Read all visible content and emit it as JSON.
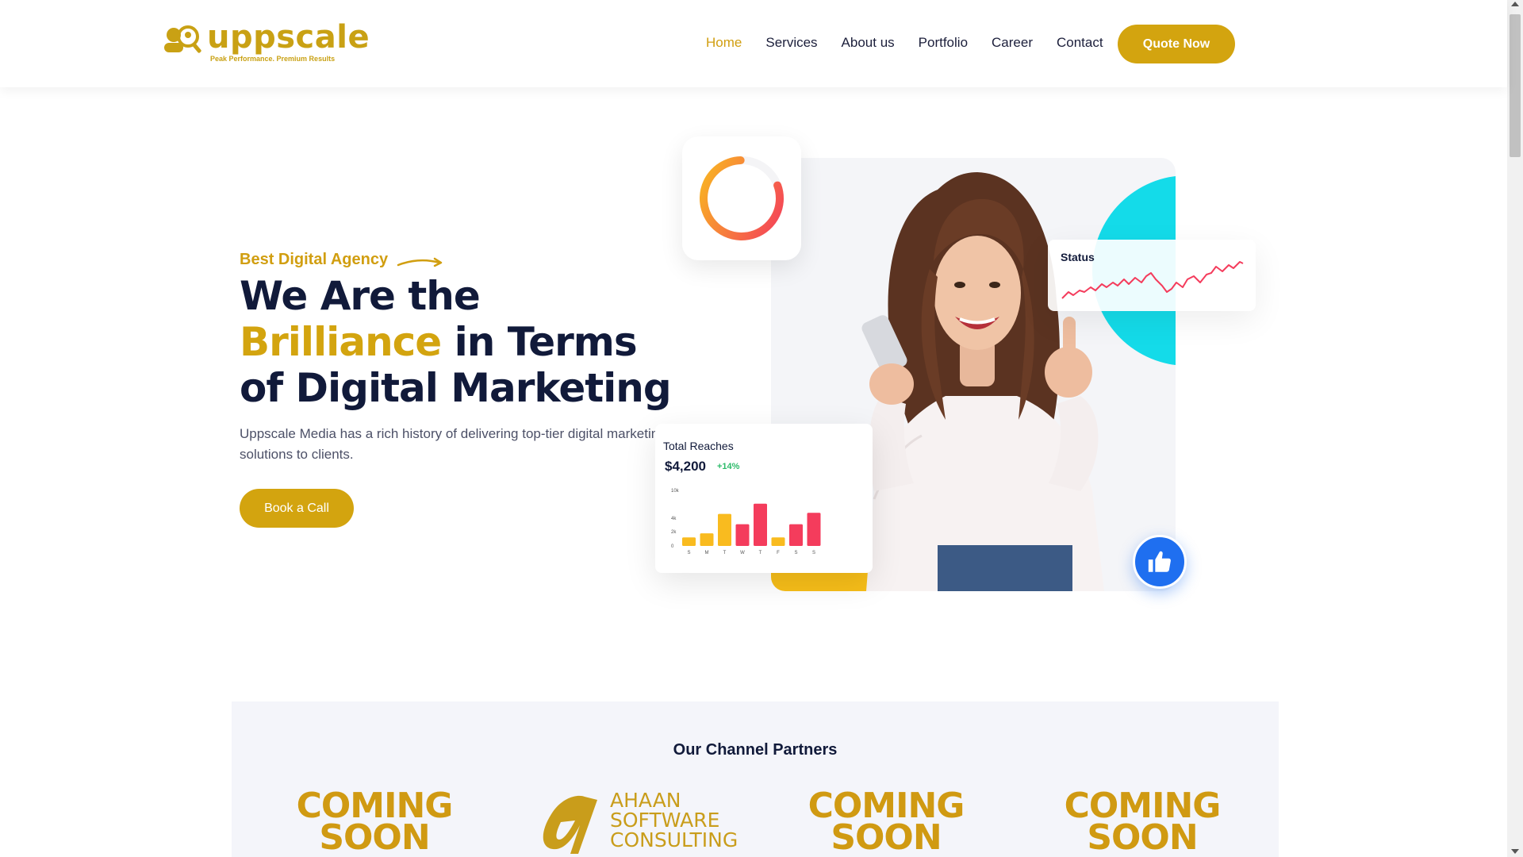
{
  "header": {
    "brand_name": "uppscale",
    "brand_tagline": "Peak Performance. Premium Results",
    "nav": [
      "Home",
      "Services",
      "About us",
      "Portfolio",
      "Career",
      "Contact"
    ],
    "cta": "Quote Now"
  },
  "hero": {
    "eyebrow": "Best Digital Agency",
    "title_part1": "We Are the ",
    "title_highlight": "Brilliance",
    "title_part2": " in Terms of Digital Marketing",
    "description_line1": "Uppscale Media has a rich history of delivering top-tier digital marketing",
    "description_line2": "solutions to clients.",
    "button": "Book a Call"
  },
  "widgets": {
    "status_title": "Status",
    "reach_title": "Total Reaches",
    "reach_value": "$4,200",
    "reach_change": "+14%",
    "progress_fraction": 0.8
  },
  "chart_data": {
    "type": "bar",
    "categories": [
      "S",
      "M",
      "T",
      "W",
      "T",
      "F",
      "S",
      "S"
    ],
    "values": [
      1.5,
      2.2,
      5.6,
      3.8,
      7.4,
      1.5,
      3.8,
      5.8
    ],
    "colors": [
      "#f9bb1f",
      "#f9bb1f",
      "#f9bb1f",
      "#f43c5c",
      "#f43c5c",
      "#f9bb1f",
      "#f43c5c",
      "#f43c5c"
    ],
    "yticks": [
      "0",
      "2k",
      "4k",
      "10k"
    ],
    "ylim": [
      0,
      10
    ]
  },
  "partners": {
    "title": "Our Channel Partners",
    "coming_line1": "COMING",
    "coming_line2": "SOON",
    "ahaan_line1": "AHAAN",
    "ahaan_line2": "SOFTWARE",
    "ahaan_line3": "CONSULTING"
  },
  "colors": {
    "brand_gold": "#d3a40f",
    "navy": "#111a3a",
    "teal": "#14dbe9",
    "like_blue": "#1f6ff0",
    "bar_red": "#f43c5c",
    "bar_yellow": "#f9bb1f"
  }
}
